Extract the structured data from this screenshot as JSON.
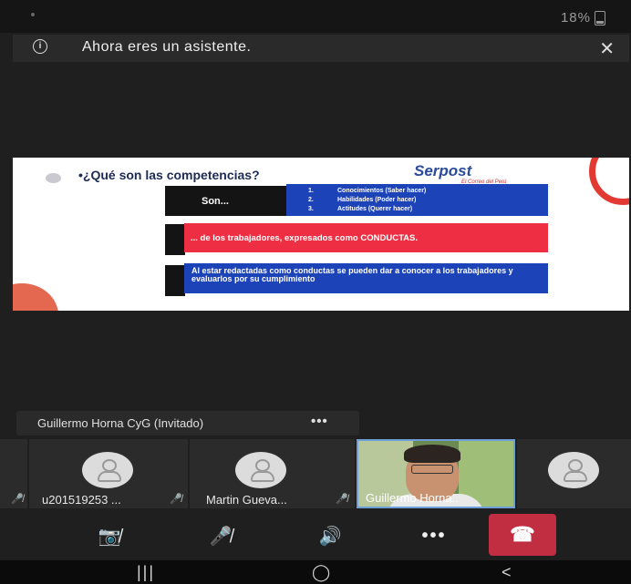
{
  "status_bar": {
    "battery": "18%"
  },
  "notice": {
    "text": "Ahora eres un asistente.",
    "close_glyph": "✕",
    "info_glyph": "i"
  },
  "slide": {
    "title": "•¿Qué son las competencias?",
    "logo": "Serpost",
    "logo_tagline": "El Correo del Perú",
    "son_label": "Son...",
    "list": [
      {
        "num": "1.",
        "text": "Conocimientos (Saber hacer)"
      },
      {
        "num": "2.",
        "text": "Habilidades (Poder hacer)"
      },
      {
        "num": "3.",
        "text": "Actitudes (Querer hacer)"
      }
    ],
    "red_text": "... de los trabajadores, expresados como CONDUCTAS.",
    "blue_text": "Al estar redactadas como conductas se pueden dar a conocer a los trabajadores y evaluarlos por su cumplimiento"
  },
  "presenter_tag": {
    "name": "Guillermo Horna CyG (Invitado)",
    "more": "•••"
  },
  "participants": [
    {
      "label": "u201519253 ...",
      "mic": "🎤̸"
    },
    {
      "label": "Martin Gueva...",
      "mic": "🎤̸"
    },
    {
      "label": "Guillermo Horna.."
    }
  ],
  "controls": {
    "camera": "📷̸",
    "mic": "🎤̸",
    "speaker": "🔊",
    "more": "•••",
    "hangup": "☎"
  },
  "navbar": {
    "recents": "|||",
    "home": "◯",
    "back": "<"
  },
  "colors": {
    "slide_blue": "#1c43b8",
    "slide_red": "#ee2f43",
    "hangup": "#c22e41",
    "active_border": "#6e9fd8"
  }
}
